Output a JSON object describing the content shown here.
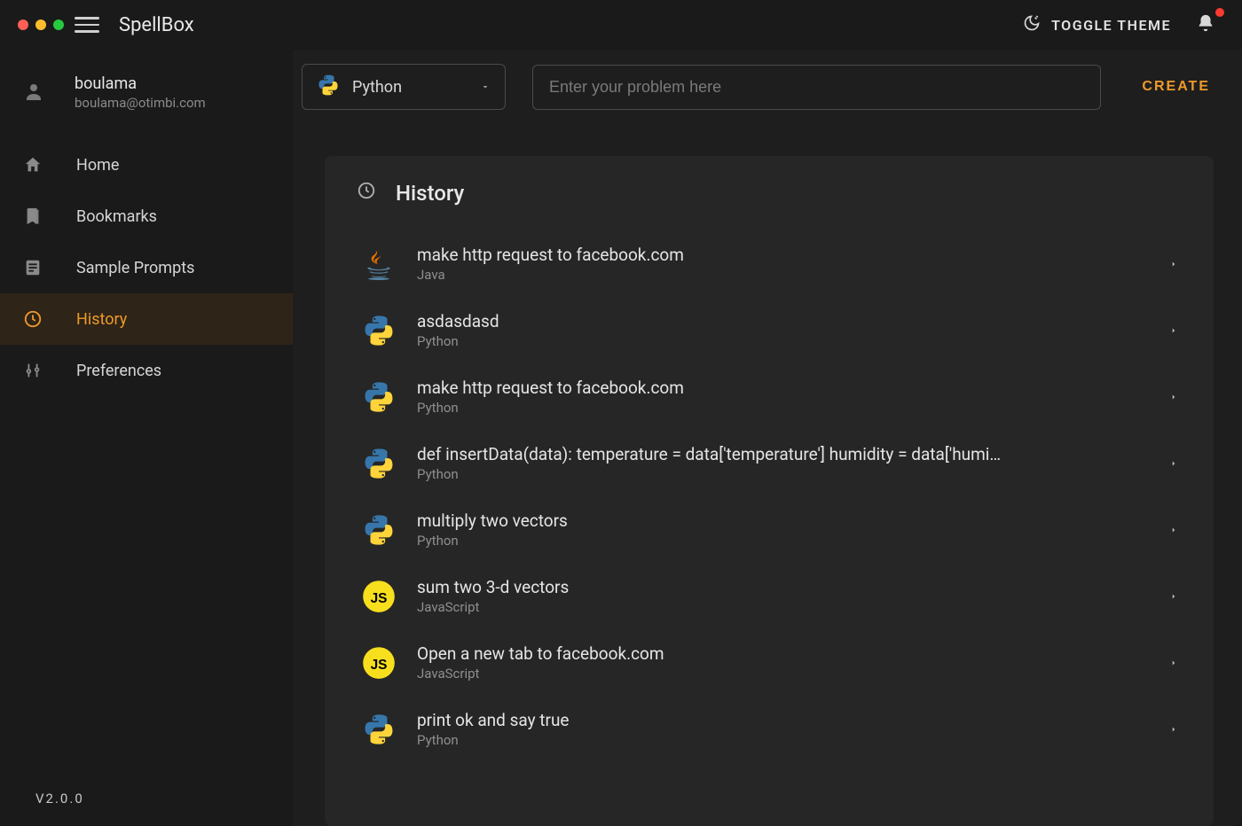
{
  "app": {
    "title": "SpellBox",
    "version": "V2.0.0"
  },
  "header": {
    "toggle_theme_label": "TOGGLE THEME"
  },
  "user": {
    "name": "boulama",
    "email": "boulama@otimbi.com"
  },
  "sidebar": {
    "items": [
      {
        "label": "Home",
        "icon": "home-icon",
        "active": false
      },
      {
        "label": "Bookmarks",
        "icon": "bookmark-icon",
        "active": false
      },
      {
        "label": "Sample Prompts",
        "icon": "document-icon",
        "active": false
      },
      {
        "label": "History",
        "icon": "clock-icon",
        "active": true
      },
      {
        "label": "Preferences",
        "icon": "sliders-icon",
        "active": false
      }
    ]
  },
  "toolbar": {
    "language_selected": "Python",
    "input_placeholder": "Enter your problem here",
    "create_label": "CREATE"
  },
  "panel": {
    "title": "History",
    "items": [
      {
        "title": "make http request to facebook.com",
        "language": "Java",
        "icon": "java"
      },
      {
        "title": "asdasdasd",
        "language": "Python",
        "icon": "python"
      },
      {
        "title": "make http request to facebook.com",
        "language": "Python",
        "icon": "python"
      },
      {
        "title": "def insertData(data): temperature = data['temperature'] humidity = data['humi…",
        "language": "Python",
        "icon": "python"
      },
      {
        "title": "multiply two vectors",
        "language": "Python",
        "icon": "python"
      },
      {
        "title": "sum two 3-d vectors",
        "language": "JavaScript",
        "icon": "javascript"
      },
      {
        "title": "Open a new tab to facebook.com",
        "language": "JavaScript",
        "icon": "javascript"
      },
      {
        "title": "print ok and say true",
        "language": "Python",
        "icon": "python"
      }
    ]
  },
  "colors": {
    "accent": "#ef9a2b",
    "bg": "#1a1a1a",
    "panel": "#262626"
  }
}
